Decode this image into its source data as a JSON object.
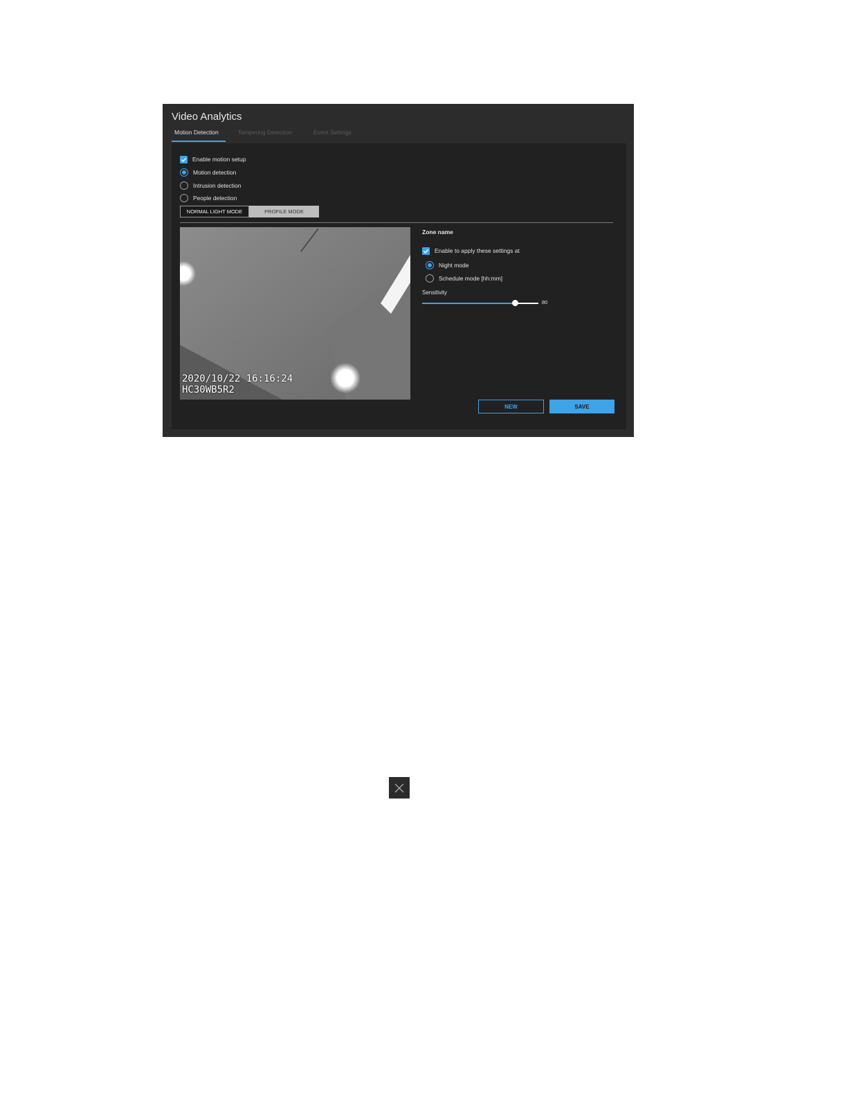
{
  "window": {
    "title": "Video Analytics",
    "tabs": [
      {
        "label": "Motion Detection",
        "active": true
      },
      {
        "label": "Tampering Detection",
        "active": false
      },
      {
        "label": "Event Settings",
        "active": false
      }
    ]
  },
  "motion": {
    "enable_label": "Enable motion setup",
    "enable_checked": true,
    "detection_options": [
      {
        "label": "Motion detection",
        "selected": true
      },
      {
        "label": "Intrusion detection",
        "selected": false
      },
      {
        "label": "People detection",
        "selected": false
      }
    ],
    "modes": {
      "normal_label": "NORMAL LIGHT MODE",
      "profile_label": "PROFILE MODE"
    }
  },
  "video": {
    "timestamp": "2020/10/22 16:16:24",
    "camera_id": "HC30WB5R2"
  },
  "zone": {
    "title": "Zone name",
    "apply_label": "Enable to apply these settings at",
    "apply_checked": true,
    "schedule_options": [
      {
        "label": "Night mode",
        "selected": true
      },
      {
        "label": "Schedule mode [hh:mm]",
        "selected": false
      }
    ],
    "sensitivity_label": "Sensitivity",
    "sensitivity_value": "80",
    "sensitivity_percent": 80
  },
  "actions": {
    "new_label": "NEW",
    "save_label": "SAVE"
  },
  "colors": {
    "accent": "#3fa3e8",
    "window_bg": "#2c2c2c",
    "panel_bg": "#212121"
  },
  "icons": {
    "check": "check-icon",
    "close": "close-icon"
  }
}
